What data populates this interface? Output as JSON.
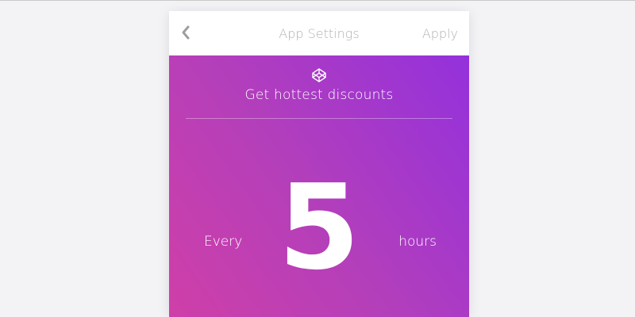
{
  "nav": {
    "title": "App Settings",
    "apply_label": "Apply",
    "back_icon": "chevron-left-icon"
  },
  "hero": {
    "logo_icon": "codepen-icon",
    "headline": "Get hottest discounts",
    "prefix": "Every",
    "value": "5",
    "unit": "hours"
  },
  "colors": {
    "background": "#f3f3f6",
    "nav_text": "#b1b1b1",
    "gradient_start": "#cf3fa8",
    "gradient_end": "#9431dc",
    "hero_text": "#ffffff"
  }
}
